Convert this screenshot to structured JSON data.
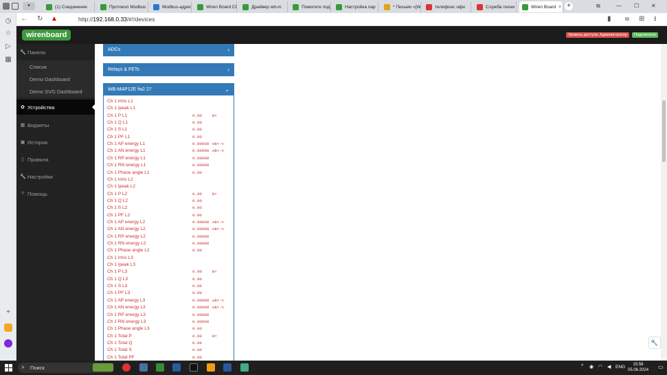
{
  "browser": {
    "tabs": [
      {
        "title": "(1) Соединение"
      },
      {
        "title": "Протокол Modbus"
      },
      {
        "title": "Modbus-адрес"
      },
      {
        "title": "Wiren Board CB"
      },
      {
        "title": "Драйвер wb-m"
      },
      {
        "title": "Помогите подь"
      },
      {
        "title": "Настройка пар"
      },
      {
        "title": "* Письмо «[Wi"
      },
      {
        "title": "телефонс офи"
      },
      {
        "title": "Служба техни"
      },
      {
        "title": "Wiren Board"
      }
    ],
    "url_prefix": "http://",
    "url_host": "192.168.0.33",
    "url_path": "/#!/devices",
    "new_tab": "+"
  },
  "header": {
    "logo": "wirenboard",
    "access_level": "Уровень доступа: Администратор",
    "status": "Подключено",
    "access_color": "#d9534f",
    "status_color": "#5cb85c"
  },
  "sidebar": {
    "items": [
      {
        "label": "Панели",
        "icon": "wrench-icon"
      },
      {
        "label": "Список"
      },
      {
        "label": "Demo Dashboard"
      },
      {
        "label": "Demo SVG Dashboard"
      },
      {
        "label": "Устройства",
        "icon": "gear-icon"
      },
      {
        "label": "Виджеты",
        "icon": "grid-icon"
      },
      {
        "label": "История",
        "icon": "history-icon"
      },
      {
        "label": "Правила",
        "icon": "file-icon"
      },
      {
        "label": "Настройки",
        "icon": "wrench-icon"
      },
      {
        "label": "Помощь",
        "icon": "question-icon"
      }
    ]
  },
  "devices": {
    "panels": [
      {
        "title": "ADCs",
        "chevron": "›"
      },
      {
        "title": "Relays & FETs",
        "chevron": "›"
      },
      {
        "title": "WB-MAP12E fw2 27",
        "chevron": "⌄"
      }
    ],
    "controls": [
      {
        "name": "Ch 1 Irms L1",
        "value": "",
        "unit": ""
      },
      {
        "name": "Ch 1 Ipeak L1",
        "value": "",
        "unit": ""
      },
      {
        "name": "Ch 1 P L1",
        "value": "0.00",
        "unit": "Вт"
      },
      {
        "name": "Ch 1 Q L1",
        "value": "0.00",
        "unit": ""
      },
      {
        "name": "Ch 1 S L1",
        "value": "0.00",
        "unit": ""
      },
      {
        "name": "Ch 1 PF L1",
        "value": "0.00",
        "unit": ""
      },
      {
        "name": "Ch 1 AP energy L1",
        "value": "0.00000",
        "unit": "кВт·ч"
      },
      {
        "name": "Ch 1 AN energy L1",
        "value": "0.00000",
        "unit": "кВт·ч"
      },
      {
        "name": "Ch 1 RP energy L1",
        "value": "0.00000",
        "unit": ""
      },
      {
        "name": "Ch 1 RN energy L1",
        "value": "0.00000",
        "unit": ""
      },
      {
        "name": "Ch 1 Phase angle L1",
        "value": "0.00",
        "unit": ""
      },
      {
        "name": "Ch 1 Irms L2",
        "value": "",
        "unit": ""
      },
      {
        "name": "Ch 1 Ipeak L2",
        "value": "",
        "unit": ""
      },
      {
        "name": "Ch 1 P L2",
        "value": "0.00",
        "unit": "Вт"
      },
      {
        "name": "Ch 1 Q L2",
        "value": "0.00",
        "unit": ""
      },
      {
        "name": "Ch 1 S L2",
        "value": "0.00",
        "unit": ""
      },
      {
        "name": "Ch 1 PF L2",
        "value": "0.00",
        "unit": ""
      },
      {
        "name": "Ch 1 AP energy L2",
        "value": "0.00000",
        "unit": "кВт·ч"
      },
      {
        "name": "Ch 1 AN energy L2",
        "value": "0.00000",
        "unit": "кВт·ч"
      },
      {
        "name": "Ch 1 RP energy L2",
        "value": "0.00000",
        "unit": ""
      },
      {
        "name": "Ch 1 RN energy L2",
        "value": "0.00000",
        "unit": ""
      },
      {
        "name": "Ch 1 Phase angle L2",
        "value": "0.00",
        "unit": ""
      },
      {
        "name": "Ch 1 Irms L3",
        "value": "",
        "unit": ""
      },
      {
        "name": "Ch 1 Ipeak L3",
        "value": "",
        "unit": ""
      },
      {
        "name": "Ch 1 P L3",
        "value": "0.00",
        "unit": "Вт"
      },
      {
        "name": "Ch 1 Q L3",
        "value": "0.00",
        "unit": ""
      },
      {
        "name": "Ch 1 S L3",
        "value": "0.00",
        "unit": ""
      },
      {
        "name": "Ch 1 PF L3",
        "value": "0.00",
        "unit": ""
      },
      {
        "name": "Ch 1 AP energy L3",
        "value": "0.00000",
        "unit": "кВт·ч"
      },
      {
        "name": "Ch 1 AN energy L3",
        "value": "0.00000",
        "unit": "кВт·ч"
      },
      {
        "name": "Ch 1 RP energy L3",
        "value": "0.00000",
        "unit": ""
      },
      {
        "name": "Ch 1 RN energy L3",
        "value": "0.00000",
        "unit": ""
      },
      {
        "name": "Ch 1 Phase angle L3",
        "value": "0.00",
        "unit": ""
      },
      {
        "name": "Ch 1 Total P",
        "value": "0.00",
        "unit": "Вт"
      },
      {
        "name": "Ch 1 Total Q",
        "value": "0.00",
        "unit": ""
      },
      {
        "name": "Ch 1 Total S",
        "value": "0.00",
        "unit": ""
      },
      {
        "name": "Ch 1 Total PF",
        "value": "0.00",
        "unit": ""
      }
    ],
    "value_color": "#c9302c"
  },
  "taskbar": {
    "search": "Поиск",
    "lang": "ENG",
    "time": "15:58",
    "date": "05.06.2024"
  }
}
